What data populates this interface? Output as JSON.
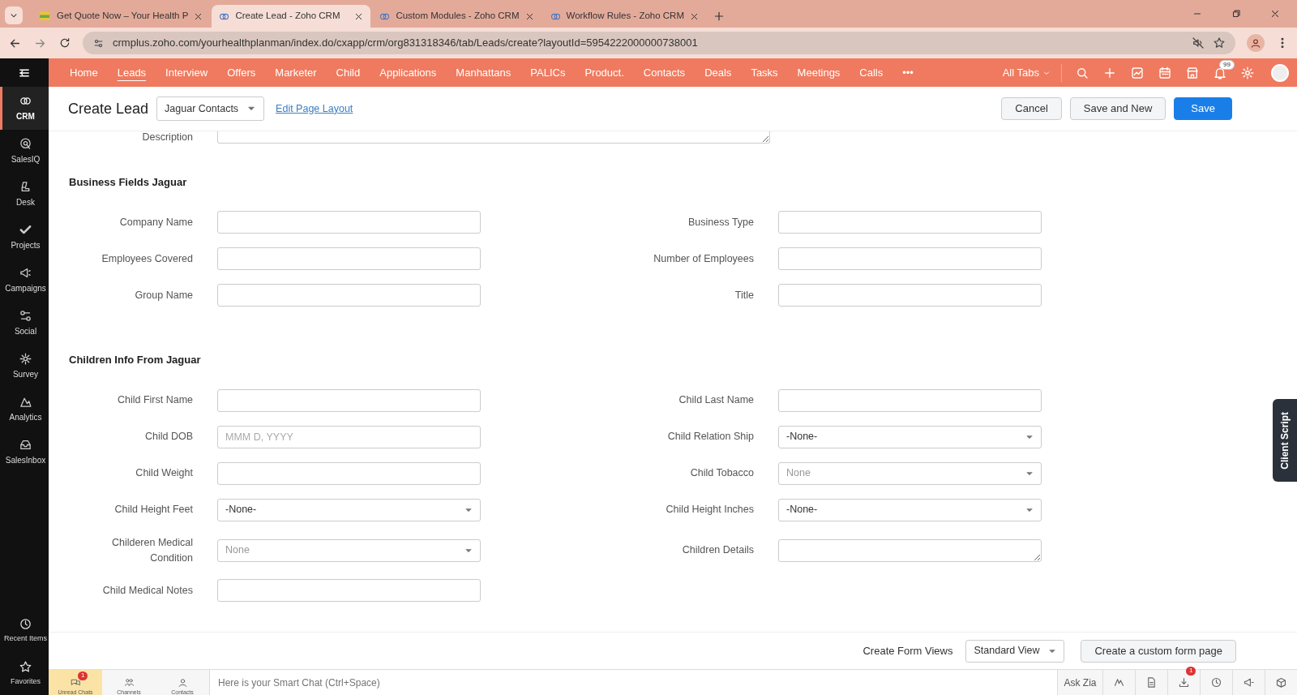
{
  "browser": {
    "tabs": [
      {
        "title": "Get Quote Now – Your Health P",
        "selected": false
      },
      {
        "title": "Create Lead - Zoho CRM",
        "selected": true
      },
      {
        "title": "Custom Modules - Zoho CRM",
        "selected": false
      },
      {
        "title": "Workflow Rules - Zoho CRM",
        "selected": false
      }
    ],
    "url": "crmplus.zoho.com/yourhealthplanman/index.do/cxapp/crm/org831318346/tab/Leads/create?layoutId=5954222000000738001"
  },
  "nav": {
    "items": [
      {
        "label": "Home",
        "selected": false
      },
      {
        "label": "Leads",
        "selected": true
      },
      {
        "label": "Interview",
        "selected": false
      },
      {
        "label": "Offers",
        "selected": false
      },
      {
        "label": "Marketer",
        "selected": false
      },
      {
        "label": "Child",
        "selected": false
      },
      {
        "label": "Applications",
        "selected": false
      },
      {
        "label": "Manhattans",
        "selected": false
      },
      {
        "label": "PALICs",
        "selected": false
      },
      {
        "label": "Product.",
        "selected": false
      },
      {
        "label": "Contacts",
        "selected": false
      },
      {
        "label": "Deals",
        "selected": false
      },
      {
        "label": "Tasks",
        "selected": false
      },
      {
        "label": "Meetings",
        "selected": false
      },
      {
        "label": "Calls",
        "selected": false
      }
    ],
    "more": "•••",
    "all_tabs": "All Tabs",
    "notification_count": "99"
  },
  "sidebar": {
    "items": [
      {
        "label": "CRM",
        "selected": true
      },
      {
        "label": "SalesIQ",
        "selected": false
      },
      {
        "label": "Desk",
        "selected": false
      },
      {
        "label": "Projects",
        "selected": false
      },
      {
        "label": "Campaigns",
        "selected": false
      },
      {
        "label": "Social",
        "selected": false
      },
      {
        "label": "Survey",
        "selected": false
      },
      {
        "label": "Analytics",
        "selected": false
      },
      {
        "label": "SalesInbox",
        "selected": false
      }
    ],
    "bottom_items": [
      {
        "label": "Recent Items"
      },
      {
        "label": "Favorites"
      }
    ]
  },
  "header": {
    "title": "Create Lead",
    "layout": "Jaguar Contacts",
    "edit_link": "Edit Page Layout",
    "buttons": [
      {
        "label": "Cancel",
        "kind": "secondary"
      },
      {
        "label": "Save and New",
        "kind": "secondary"
      },
      {
        "label": "Save",
        "kind": "primary"
      }
    ]
  },
  "description": {
    "label": "Description"
  },
  "sections": [
    {
      "title": "Business Fields Jaguar",
      "rows": [
        {
          "left": {
            "label": "Company Name",
            "kind": "text"
          },
          "right": {
            "label": "Business Type",
            "kind": "text"
          }
        },
        {
          "left": {
            "label": "Employees Covered",
            "kind": "text"
          },
          "right": {
            "label": "Number of Employees",
            "kind": "text"
          }
        },
        {
          "left": {
            "label": "Group Name",
            "kind": "text"
          },
          "right": {
            "label": "Title",
            "kind": "text"
          }
        }
      ]
    },
    {
      "title": "Children Info From Jaguar",
      "rows": [
        {
          "left": {
            "label": "Child First Name",
            "kind": "text"
          },
          "right": {
            "label": "Child Last Name",
            "kind": "text"
          }
        },
        {
          "left": {
            "label": "Child DOB",
            "kind": "date",
            "placeholder": "MMM D, YYYY"
          },
          "right": {
            "label": "Child Relation Ship",
            "kind": "select",
            "value": "-None-"
          }
        },
        {
          "left": {
            "label": "Child Weight",
            "kind": "text"
          },
          "right": {
            "label": "Child Tobacco",
            "kind": "select",
            "placeholder": "None"
          }
        },
        {
          "left": {
            "label": "Child Height Feet",
            "kind": "select",
            "value": "-None-"
          },
          "right": {
            "label": "Child Height Inches",
            "kind": "select",
            "value": "-None-"
          }
        },
        {
          "left": {
            "label": "Childeren Medical Condition",
            "kind": "select",
            "placeholder": "None"
          },
          "right": {
            "label": "Children Details",
            "kind": "textarea"
          }
        },
        {
          "left": {
            "label": "Child Medical Notes",
            "kind": "text"
          }
        }
      ]
    }
  ],
  "client_script": "Client Script",
  "footer": {
    "label": "Create Form Views",
    "view": "Standard View",
    "button": "Create a custom form page"
  },
  "chat_bar": {
    "tabs": [
      {
        "label": "Unread Chats",
        "selected": true,
        "badge": "1"
      },
      {
        "label": "Channels",
        "selected": false
      },
      {
        "label": "Contacts",
        "selected": false
      }
    ],
    "placeholder": "Here is your Smart Chat (Ctrl+Space)",
    "ask_zia": "Ask Zia",
    "download_badge": "1"
  }
}
